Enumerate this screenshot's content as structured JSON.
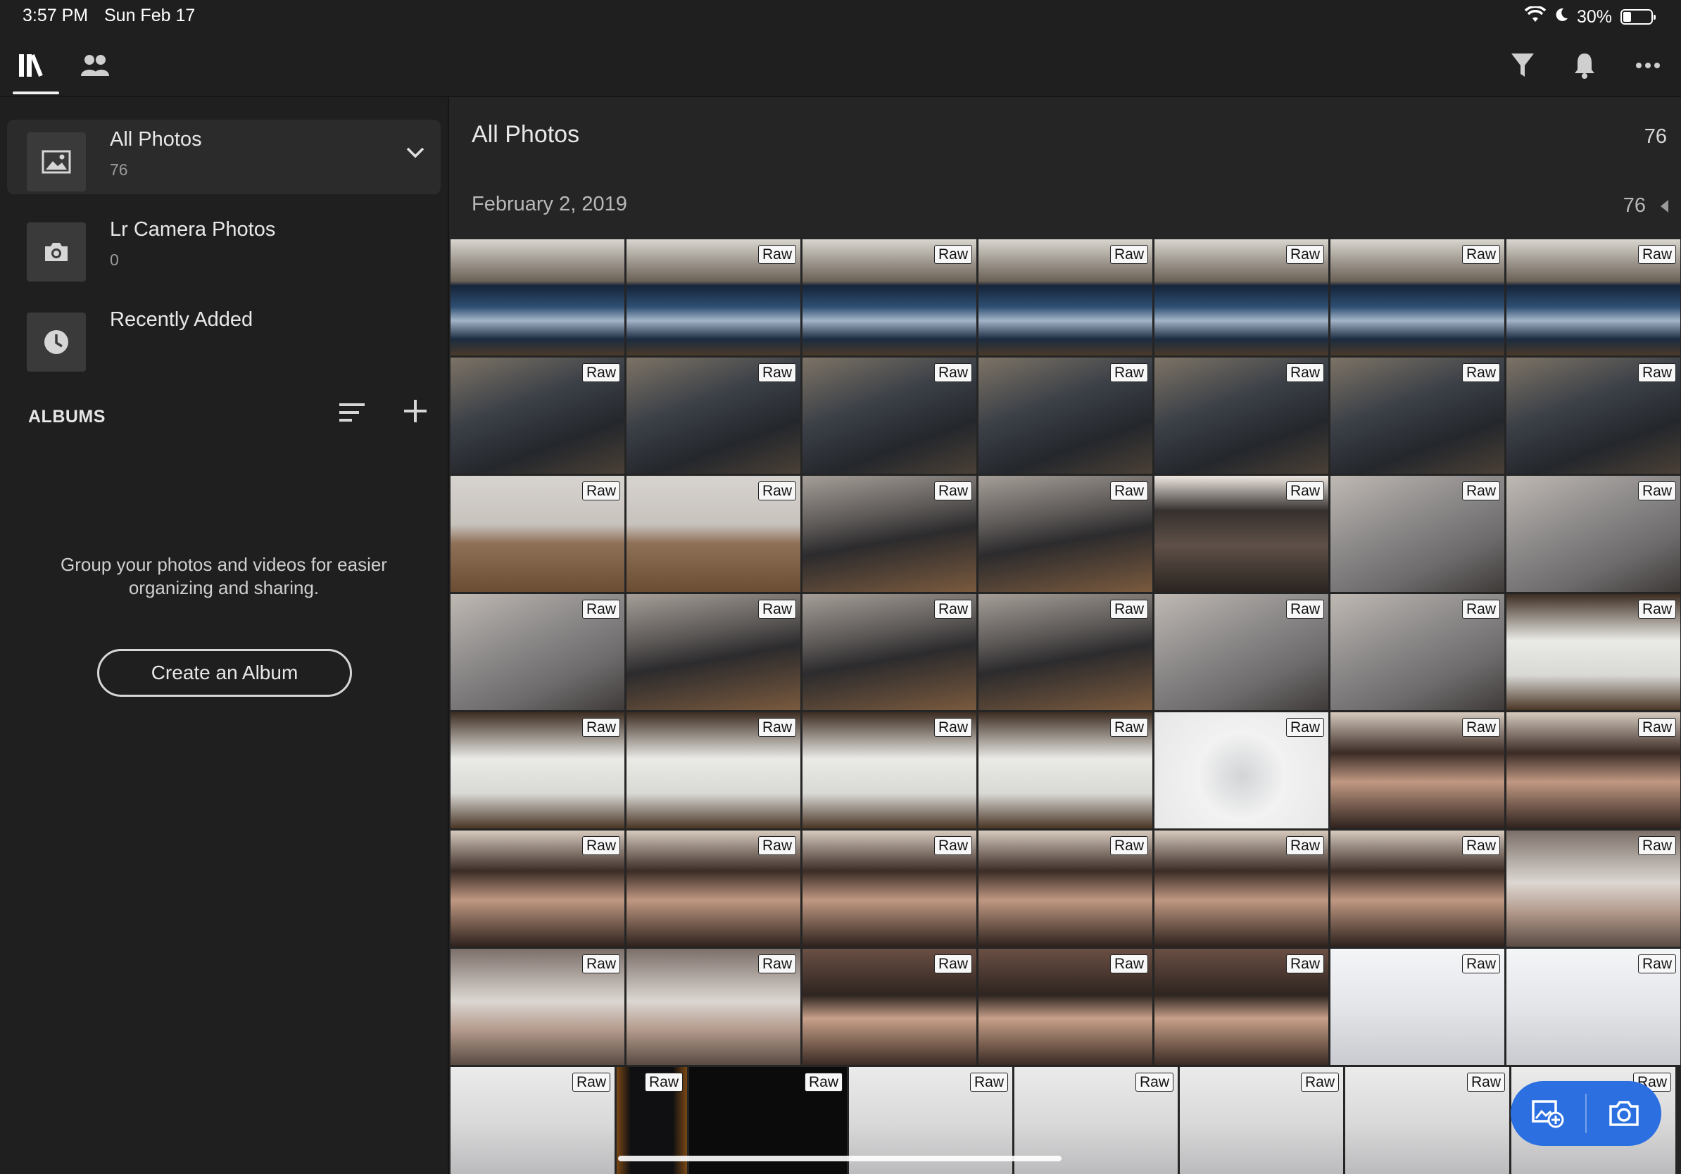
{
  "status_bar": {
    "time": "3:57 PM",
    "date": "Sun Feb 17",
    "battery": "30%",
    "battery_level": 0.3,
    "icons": [
      "wifi-icon",
      "moon-icon",
      "battery-icon"
    ]
  },
  "toolbar": {
    "left_icons": [
      "library-icon",
      "people-icon"
    ],
    "right_icons": [
      "filter-icon",
      "bell-icon",
      "more-icon"
    ]
  },
  "sidebar": {
    "sources": [
      {
        "title": "All Photos",
        "count": "76",
        "icon": "image-icon"
      },
      {
        "title": "Lr Camera Photos",
        "count": "0",
        "icon": "camera-icon"
      },
      {
        "title": "Recently Added",
        "icon": "clock-icon"
      }
    ],
    "albums_heading": "ALBUMS",
    "empty_message": "Group your photos and videos for easier organizing and sharing.",
    "create_album_label": "Create an Album"
  },
  "main": {
    "title": "All Photos",
    "count": "76",
    "groups": [
      {
        "date": "February 2, 2019",
        "count": "76"
      }
    ],
    "badge_label": "Raw",
    "photo_rows": [
      [
        "ipad",
        "ipad",
        "ipad",
        "ipad",
        "ipad",
        "ipad",
        "ipad"
      ],
      [
        "pencil",
        "pencil",
        "pencil",
        "pencil",
        "pencil",
        "pencil",
        "pencil"
      ],
      [
        "desk",
        "desk",
        "deskdk",
        "deskdk",
        "window",
        "back",
        "back"
      ],
      [
        "back",
        "deskdk",
        "deskdk",
        "deskdk",
        "back",
        "back",
        "boxes"
      ],
      [
        "boxes",
        "boxes",
        "boxes",
        "boxes",
        "cable",
        "hand",
        "hand"
      ],
      [
        "hand",
        "hand",
        "hand",
        "hand",
        "hand",
        "hand",
        "handlt"
      ],
      [
        "handlt",
        "handlt",
        "coil",
        "coil",
        "coil",
        "paper",
        "paper"
      ]
    ],
    "partial_row": [
      "docs",
      "orange",
      "black",
      "docs",
      "docs",
      "docs",
      "docs",
      "docs"
    ]
  },
  "fab": {
    "icons": [
      "add-photo-icon",
      "camera-icon"
    ],
    "color": "#2b6fe0"
  }
}
